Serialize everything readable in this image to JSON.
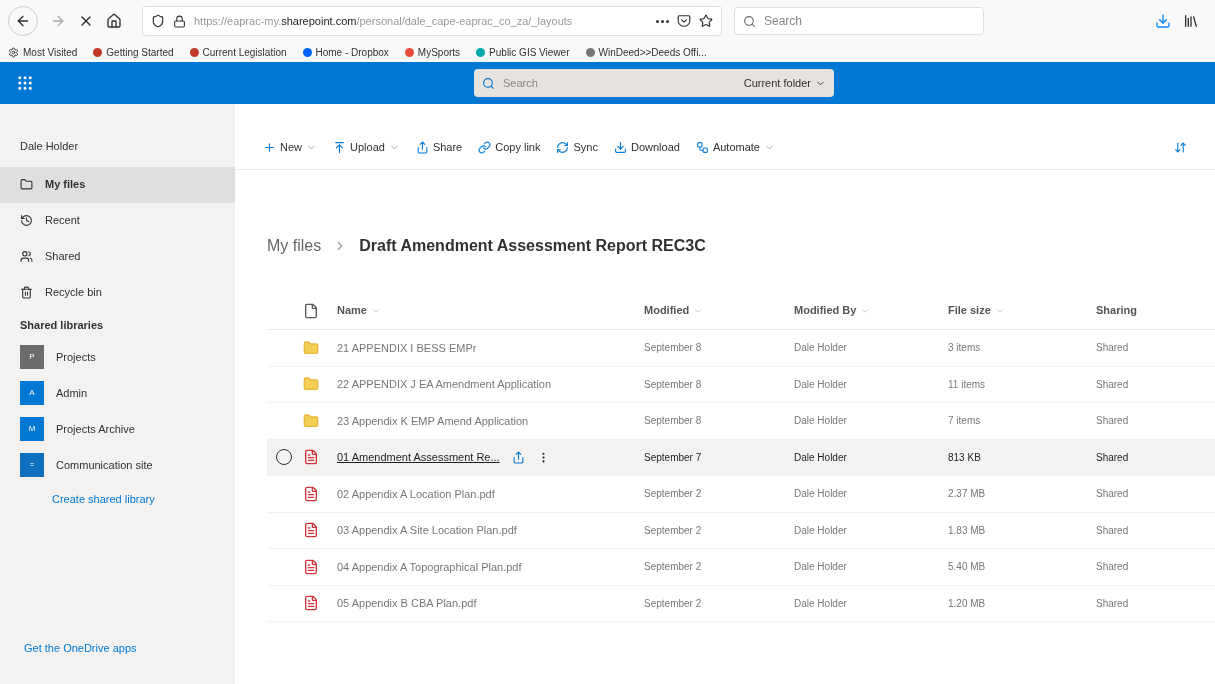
{
  "browser": {
    "url_domain": "sharepoint.com",
    "url_prefix": "https://eaprac-my.",
    "url_rest": "/personal/dale_cape-eaprac_co_za/_layouts",
    "search_placeholder": "Search",
    "bookmarks": [
      {
        "label": "Most Visited"
      },
      {
        "label": "Getting Started"
      },
      {
        "label": "Current Legislation"
      },
      {
        "label": "Home - Dropbox"
      },
      {
        "label": "MySports"
      },
      {
        "label": "Public GIS Viewer"
      },
      {
        "label": "WinDeed>>Deeds Offi..."
      }
    ]
  },
  "suite": {
    "search_placeholder": "Search",
    "scope": "Current folder"
  },
  "sidebar": {
    "user": "Dale Holder",
    "items": [
      {
        "label": "My files",
        "selected": true
      },
      {
        "label": "Recent",
        "selected": false
      },
      {
        "label": "Shared",
        "selected": false
      },
      {
        "label": "Recycle bin",
        "selected": false
      }
    ],
    "section": "Shared libraries",
    "libraries": [
      {
        "label": "Projects",
        "initial": "P",
        "color": "#6b6b6b"
      },
      {
        "label": "Admin",
        "initial": "A",
        "color": "#0078d4"
      },
      {
        "label": "Projects Archive",
        "initial": "M",
        "color": "#0078d4"
      },
      {
        "label": "Communication site",
        "initial": "=",
        "color": "#106ebe"
      }
    ],
    "create_link": "Create shared library",
    "footer_link": "Get the OneDrive apps"
  },
  "commands": [
    {
      "label": "New",
      "dropdown": true
    },
    {
      "label": "Upload",
      "dropdown": true
    },
    {
      "label": "Share",
      "dropdown": false
    },
    {
      "label": "Copy link",
      "dropdown": false
    },
    {
      "label": "Sync",
      "dropdown": false
    },
    {
      "label": "Download",
      "dropdown": false
    },
    {
      "label": "Automate",
      "dropdown": true
    }
  ],
  "breadcrumb": {
    "root": "My files",
    "current": "Draft Amendment Assessment Report REC3C"
  },
  "columns": [
    {
      "label": "Name",
      "sortable": true
    },
    {
      "label": "Modified",
      "sortable": true
    },
    {
      "label": "Modified By",
      "sortable": true
    },
    {
      "label": "File size",
      "sortable": true
    },
    {
      "label": "Sharing",
      "sortable": false
    }
  ],
  "rows": [
    {
      "kind": "folder",
      "name": "21 APPENDIX I BESS EMPr",
      "modified": "September 8",
      "modified_by": "Dale Holder",
      "size": "3 items",
      "sharing": "Shared",
      "hovered": false
    },
    {
      "kind": "folder",
      "name": "22 APPENDIX J EA Amendment Application",
      "modified": "September 8",
      "modified_by": "Dale Holder",
      "size": "11 items",
      "sharing": "Shared",
      "hovered": false
    },
    {
      "kind": "folder",
      "name": "23 Appendix K EMP Amend Application",
      "modified": "September 8",
      "modified_by": "Dale Holder",
      "size": "7 items",
      "sharing": "Shared",
      "hovered": false
    },
    {
      "kind": "pdf",
      "name": "01 Amendment Assessment Re...",
      "modified": "September 7",
      "modified_by": "Dale Holder",
      "size": "813 KB",
      "sharing": "Shared",
      "hovered": true
    },
    {
      "kind": "pdf",
      "name": "02 Appendix A Location Plan.pdf",
      "modified": "September 2",
      "modified_by": "Dale Holder",
      "size": "2.37 MB",
      "sharing": "Shared",
      "hovered": false
    },
    {
      "kind": "pdf",
      "name": "03 Appendix A Site Location Plan.pdf",
      "modified": "September 2",
      "modified_by": "Dale Holder",
      "size": "1.83 MB",
      "sharing": "Shared",
      "hovered": false
    },
    {
      "kind": "pdf",
      "name": "04 Appendix A Topographical Plan.pdf",
      "modified": "September 2",
      "modified_by": "Dale Holder",
      "size": "5.40 MB",
      "sharing": "Shared",
      "hovered": false
    },
    {
      "kind": "pdf",
      "name": "05 Appendix B CBA Plan.pdf",
      "modified": "September 2",
      "modified_by": "Dale Holder",
      "size": "1.20 MB",
      "sharing": "Shared",
      "hovered": false
    }
  ]
}
